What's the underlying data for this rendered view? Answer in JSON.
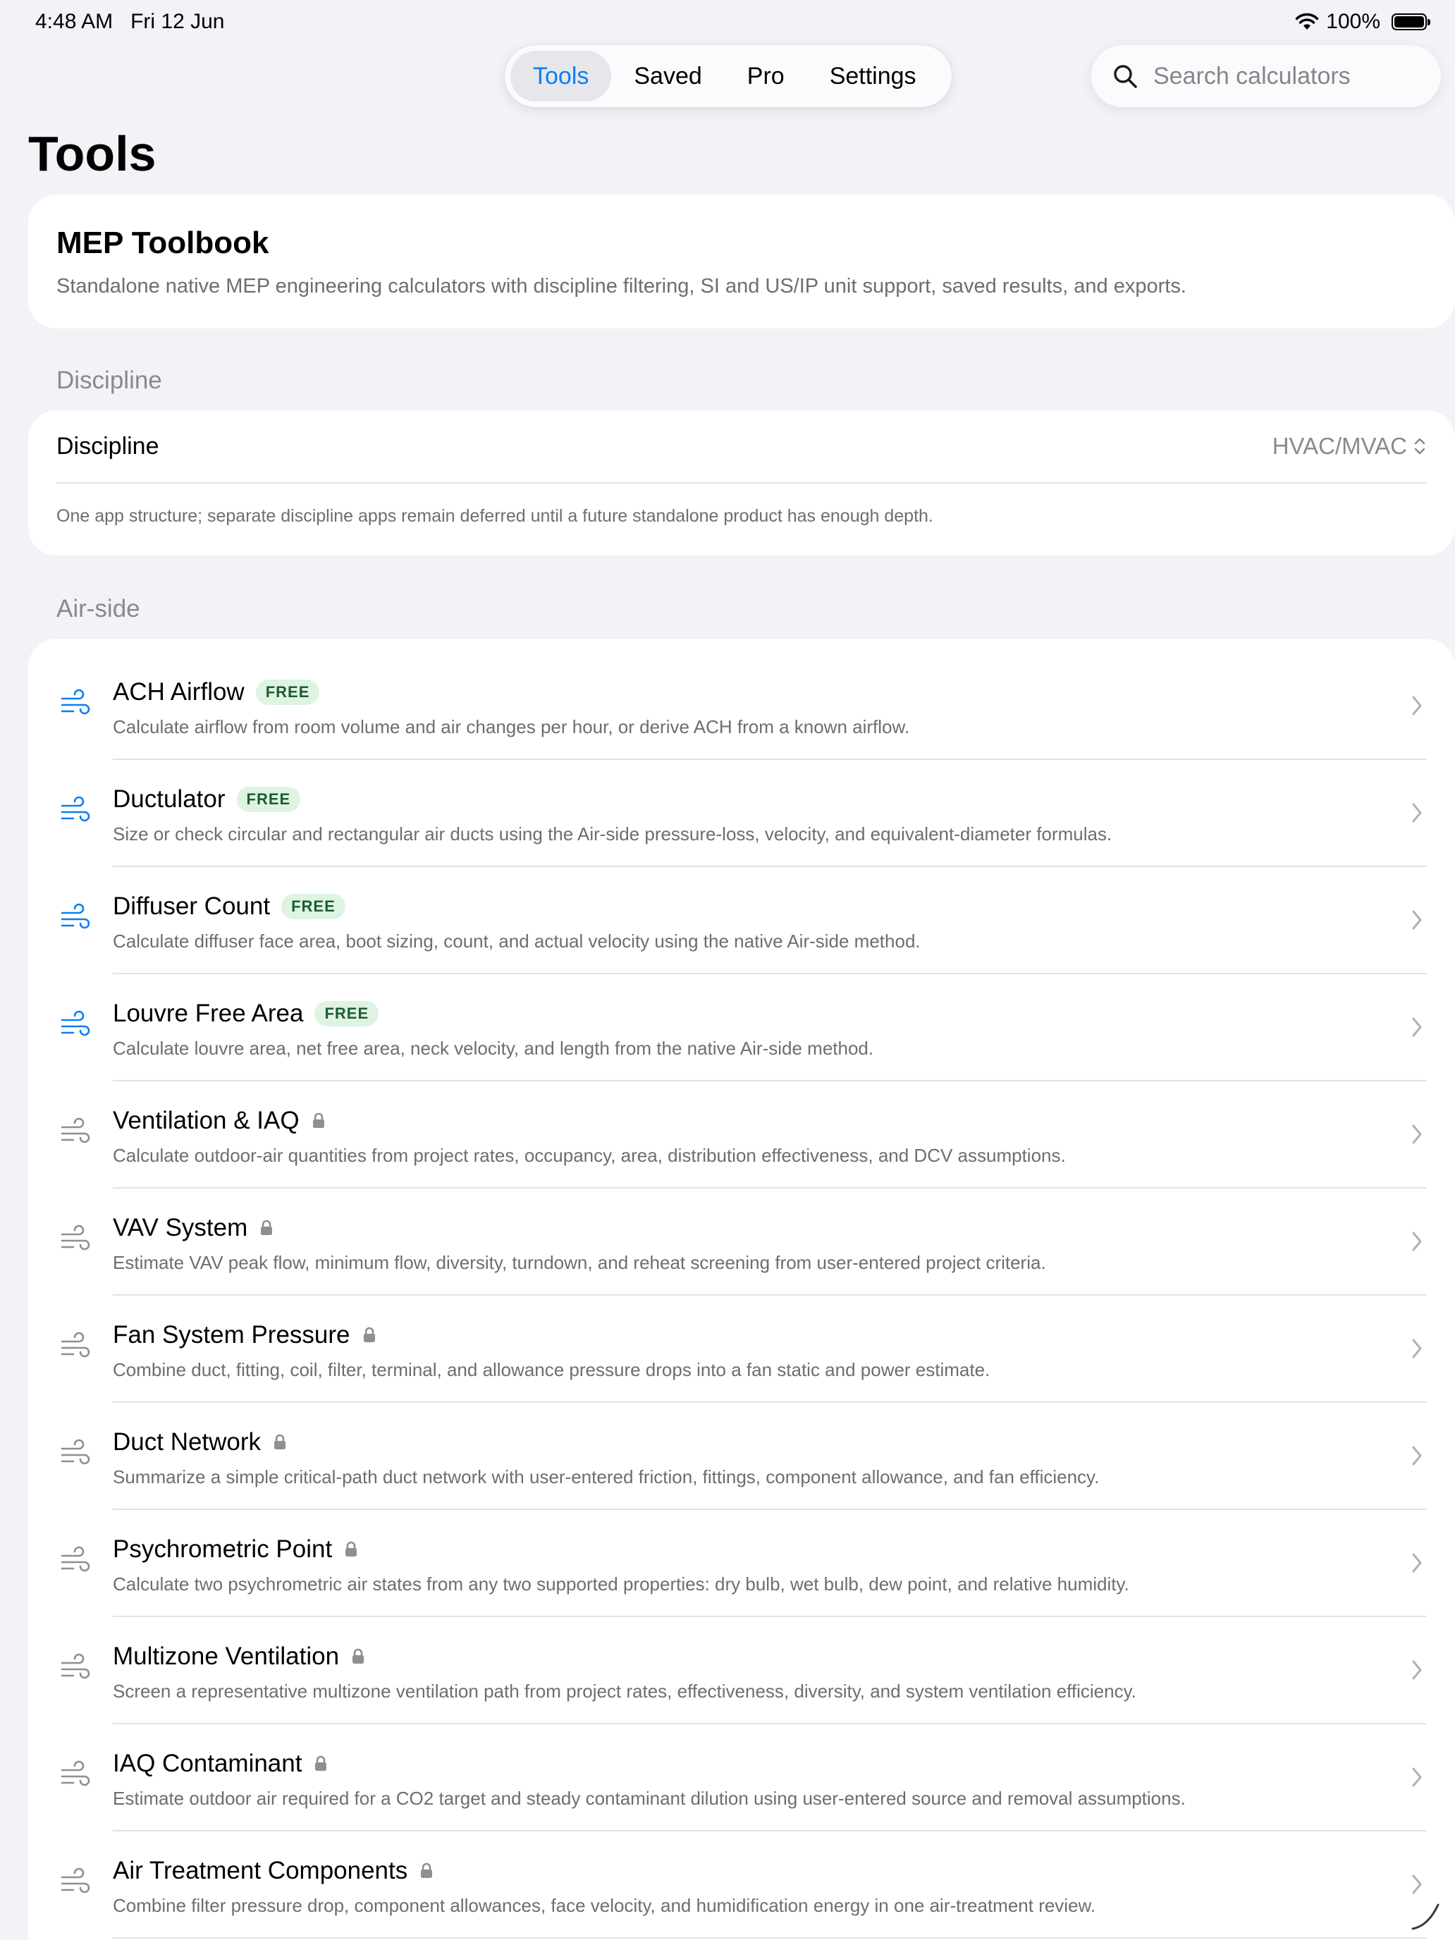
{
  "status_bar": {
    "time": "4:48 AM",
    "date": "Fri 12 Jun",
    "battery": "100%"
  },
  "tabs": [
    {
      "label": "Tools",
      "active": true
    },
    {
      "label": "Saved",
      "active": false
    },
    {
      "label": "Pro",
      "active": false
    },
    {
      "label": "Settings",
      "active": false
    }
  ],
  "search": {
    "placeholder": "Search calculators",
    "value": ""
  },
  "page_title": "Tools",
  "intro": {
    "title": "MEP Toolbook",
    "description": "Standalone native MEP engineering calculators with discipline filtering, SI and US/IP unit support, saved results, and exports."
  },
  "discipline_section": {
    "header": "Discipline",
    "label": "Discipline",
    "value": "HVAC/MVAC",
    "note": "One app structure; separate discipline apps remain deferred until a future standalone product has enough depth."
  },
  "airside_section": {
    "header": "Air-side",
    "items": [
      {
        "title": "ACH Airflow",
        "free": true,
        "badge": "FREE",
        "description": "Calculate airflow from room volume and air changes per hour, or derive ACH from a known airflow."
      },
      {
        "title": "Ductulator",
        "free": true,
        "badge": "FREE",
        "description": "Size or check circular and rectangular air ducts using the Air-side pressure-loss, velocity, and equivalent-diameter formulas."
      },
      {
        "title": "Diffuser Count",
        "free": true,
        "badge": "FREE",
        "description": "Calculate diffuser face area, boot sizing, count, and actual velocity using the native Air-side method."
      },
      {
        "title": "Louvre Free Area",
        "free": true,
        "badge": "FREE",
        "description": "Calculate louvre area, net free area, neck velocity, and length from the native Air-side method."
      },
      {
        "title": "Ventilation & IAQ",
        "free": false,
        "badge": "",
        "description": "Calculate outdoor-air quantities from project rates, occupancy, area, distribution effectiveness, and DCV assumptions."
      },
      {
        "title": "VAV System",
        "free": false,
        "badge": "",
        "description": "Estimate VAV peak flow, minimum flow, diversity, turndown, and reheat screening from user-entered project criteria."
      },
      {
        "title": "Fan System Pressure",
        "free": false,
        "badge": "",
        "description": "Combine duct, fitting, coil, filter, terminal, and allowance pressure drops into a fan static and power estimate."
      },
      {
        "title": "Duct Network",
        "free": false,
        "badge": "",
        "description": "Summarize a simple critical-path duct network with user-entered friction, fittings, component allowance, and fan efficiency."
      },
      {
        "title": "Psychrometric Point",
        "free": false,
        "badge": "",
        "description": "Calculate two psychrometric air states from any two supported properties: dry bulb, wet bulb, dew point, and relative humidity."
      },
      {
        "title": "Multizone Ventilation",
        "free": false,
        "badge": "",
        "description": "Screen a representative multizone ventilation path from project rates, effectiveness, diversity, and system ventilation efficiency."
      },
      {
        "title": "IAQ Contaminant",
        "free": false,
        "badge": "",
        "description": "Estimate outdoor air required for a CO2 target and steady contaminant dilution using user-entered source and removal assumptions."
      },
      {
        "title": "Air Treatment Components",
        "free": false,
        "badge": "",
        "description": "Combine filter pressure drop, component allowances, face velocity, and humidification energy in one air-treatment review."
      }
    ]
  },
  "colors": {
    "accent": "#0a7ff5",
    "free_badge_bg": "#def3e2",
    "free_badge_text": "#1d5c33",
    "locked_icon": "#8e8e93"
  },
  "icons": {
    "free_item": "wind-icon",
    "locked_item": "wind-icon",
    "lock": "lock-icon",
    "row": "chevron-right-icon"
  }
}
